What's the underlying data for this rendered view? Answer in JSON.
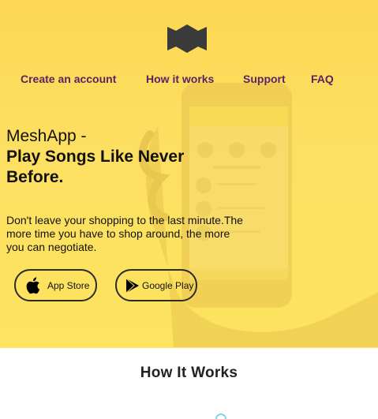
{
  "nav": {
    "items": [
      {
        "label": "Create an account"
      },
      {
        "label": "How it works"
      },
      {
        "label": "Support"
      },
      {
        "label": "FAQ"
      }
    ]
  },
  "hero": {
    "brand": "MeshApp -",
    "tagline": "Play Songs Like Never Before.",
    "description": "Don't leave your shopping to the last minute.The more time you have to shop around, the more you can negotiate."
  },
  "buttons": {
    "app_store": {
      "label": "App Store",
      "icon": "apple-icon"
    },
    "google_play": {
      "label": "Google Play",
      "icon": "play-store-icon"
    }
  },
  "section": {
    "how_it_works_title": "How It Works"
  },
  "colors": {
    "hero_background": "#fde062",
    "nav_link": "#5b2266",
    "text": "#111111",
    "accent_ring": "#80d8e6"
  }
}
